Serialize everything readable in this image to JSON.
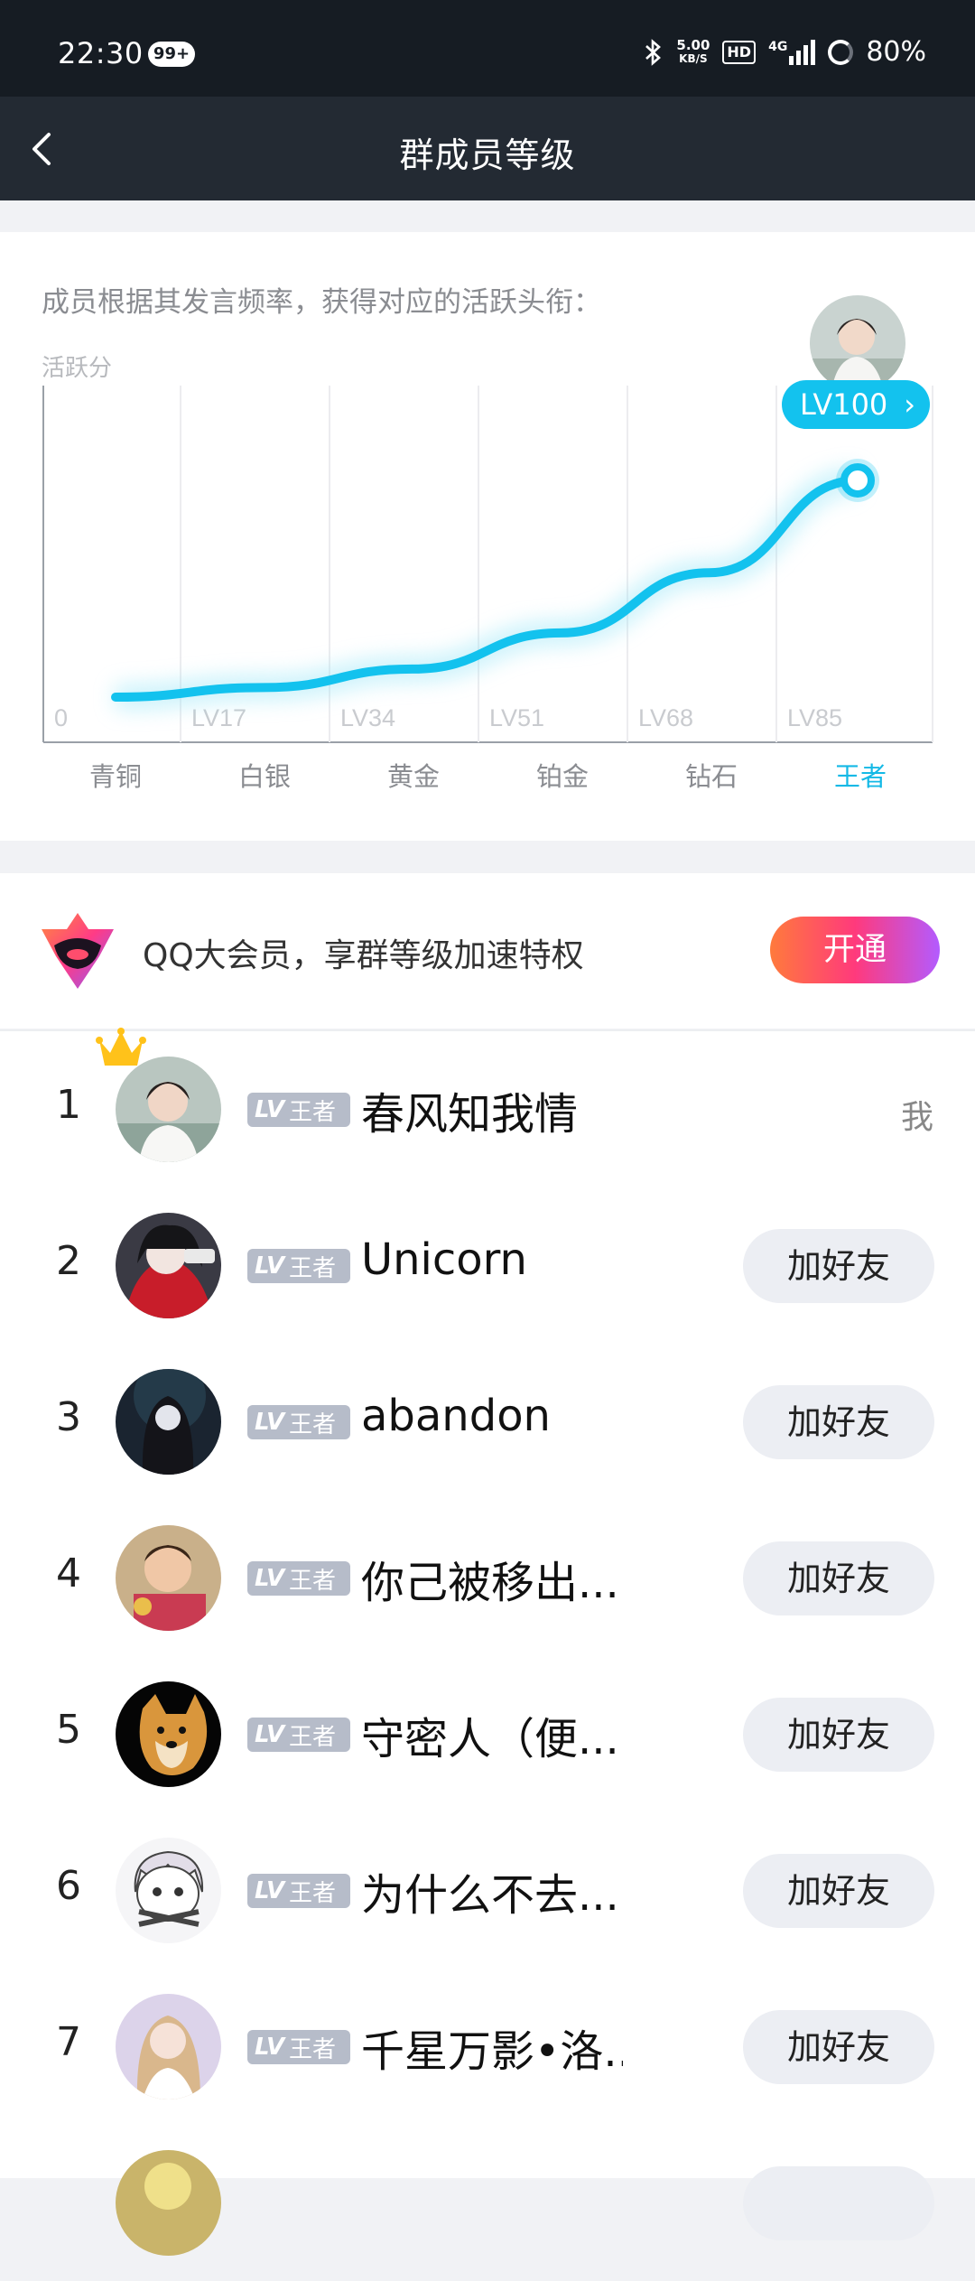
{
  "status_bar": {
    "time": "22:30",
    "notification_badge": "99+",
    "net_speed_value": "5.00",
    "net_speed_unit": "KB/S",
    "hd_label": "HD",
    "network_type": "4G",
    "battery": "80%"
  },
  "nav": {
    "title": "群成员等级",
    "back_icon": "chevron-left-icon"
  },
  "level_card": {
    "description": "成员根据其发言频率，获得对应的活跃头衔：",
    "current_level": "LV100"
  },
  "chart_data": {
    "type": "line",
    "ylabel": "活跃分",
    "level_ticks": [
      "0",
      "LV17",
      "LV34",
      "LV51",
      "LV68",
      "LV85"
    ],
    "categories": [
      "青铜",
      "白银",
      "黄金",
      "铂金",
      "钻石",
      "王者"
    ],
    "active_category": "王者",
    "series": [
      {
        "values": [
          1,
          2.2,
          4.5,
          9,
          16.5,
          28
        ]
      }
    ],
    "marker": "王者",
    "grid": true,
    "accent_color": "#13c2ee"
  },
  "vip_banner": {
    "text": "QQ大会员，享群等级加速特权",
    "button_label": "开通",
    "logo_icon": "qq-vip-logo-icon"
  },
  "members": [
    {
      "rank": "1",
      "lv_badge": "LV",
      "tier": "王者",
      "name": "春风知我情",
      "action": "我",
      "is_me": true,
      "crown": true
    },
    {
      "rank": "2",
      "lv_badge": "LV",
      "tier": "王者",
      "name": "Unicorn",
      "action": "加好友",
      "is_me": false
    },
    {
      "rank": "3",
      "lv_badge": "LV",
      "tier": "王者",
      "name": "abandon",
      "action": "加好友",
      "is_me": false
    },
    {
      "rank": "4",
      "lv_badge": "LV",
      "tier": "王者",
      "name": "你己被移出...",
      "action": "加好友",
      "is_me": false
    },
    {
      "rank": "5",
      "lv_badge": "LV",
      "tier": "王者",
      "name": "守密人（便...",
      "action": "加好友",
      "is_me": false
    },
    {
      "rank": "6",
      "lv_badge": "LV",
      "tier": "王者",
      "name": "为什么不去...",
      "action": "加好友",
      "is_me": false
    },
    {
      "rank": "7",
      "lv_badge": "LV",
      "tier": "王者",
      "name": "千星万影•洛...",
      "action": "加好友",
      "is_me": false
    }
  ],
  "colors": {
    "accent": "#13c2ee",
    "badge_gray": "#b6bcc9",
    "nav_bg": "#232a33",
    "status_bg": "#161c23"
  }
}
